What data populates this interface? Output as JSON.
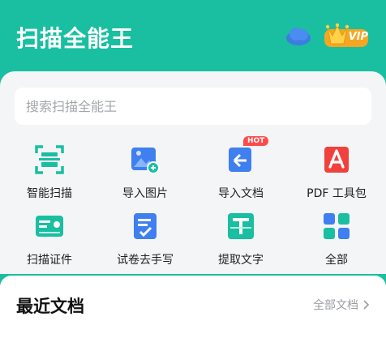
{
  "header": {
    "title": "扫描全能王",
    "cloud_icon": "cloud-icon",
    "vip_label": "VIP"
  },
  "search": {
    "placeholder": "搜索扫描全能王"
  },
  "tools": [
    {
      "label": "智能扫描",
      "icon": "smart-scan-icon"
    },
    {
      "label": "导入图片",
      "icon": "import-image-icon"
    },
    {
      "label": "导入文档",
      "icon": "import-doc-icon",
      "badge": "HOT"
    },
    {
      "label": "PDF 工具包",
      "icon": "pdf-toolkit-icon"
    },
    {
      "label": "扫描证件",
      "icon": "id-card-scan-icon"
    },
    {
      "label": "试卷去手写",
      "icon": "remove-handwriting-icon"
    },
    {
      "label": "提取文字",
      "icon": "extract-text-icon"
    },
    {
      "label": "全部",
      "icon": "all-apps-icon"
    }
  ],
  "recent": {
    "title": "最近文档",
    "all_docs_label": "全部文档"
  },
  "colors": {
    "brand": "#19bfa0",
    "hot_badge": "#ff4a4a",
    "vip_gold": "#f5b731"
  }
}
